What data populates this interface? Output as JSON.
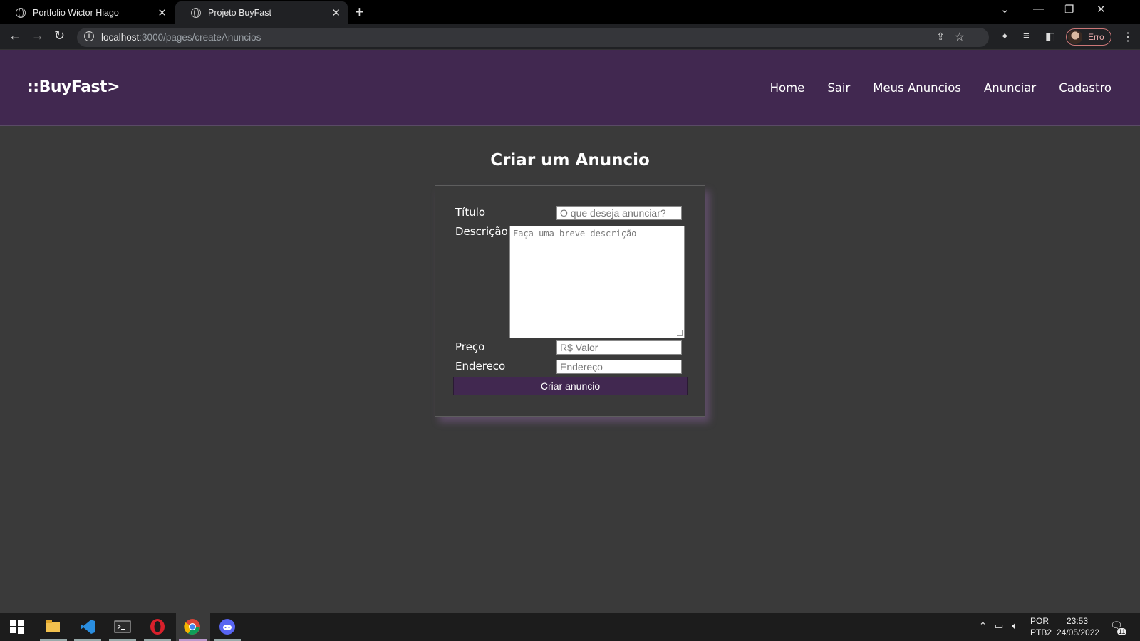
{
  "browser": {
    "tabs": [
      {
        "title": "Portfolio Wictor Hiago"
      },
      {
        "title": "Projeto BuyFast"
      }
    ],
    "url_host": "localhost",
    "url_rest": ":3000/pages/createAnuncios",
    "profile_label": "Erro"
  },
  "site": {
    "logo": "::BuyFast>",
    "nav": [
      "Home",
      "Sair",
      "Meus Anuncios",
      "Anunciar",
      "Cadastro"
    ]
  },
  "form": {
    "title": "Criar um Anuncio",
    "titulo_label": "Título",
    "titulo_placeholder": "O que deseja anunciar?",
    "descricao_label": "Descrição",
    "descricao_placeholder": "Faça uma breve descrição",
    "preco_label": "Preço",
    "preco_placeholder": "R$ Valor",
    "endereco_label": "Endereco",
    "endereco_placeholder": "Endereço",
    "submit_label": "Criar anuncio"
  },
  "taskbar": {
    "lang_top": "POR",
    "lang_bottom": "PTB2",
    "time": "23:53",
    "date": "24/05/2022",
    "notification_count": "11"
  },
  "colors": {
    "header_bg": "#412850",
    "page_bg": "#3a3a3a",
    "button_bg": "#412850"
  }
}
